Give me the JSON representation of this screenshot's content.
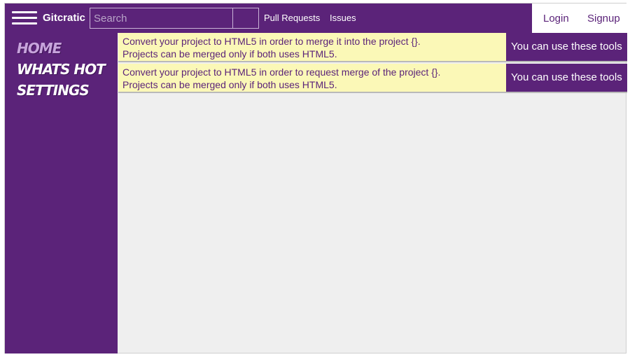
{
  "header": {
    "brand": "Gitcratic",
    "search": {
      "placeholder": "Search",
      "value": ""
    },
    "links": [
      "Pull Requests",
      "Issues"
    ],
    "auth": {
      "login": "Login",
      "signup": "Signup"
    }
  },
  "sidebar": {
    "items": [
      {
        "label": "Home",
        "active": true
      },
      {
        "label": "Whats Hot",
        "active": false
      },
      {
        "label": "Settings",
        "active": false
      }
    ]
  },
  "notices": [
    {
      "line1": "Convert your project to HTML5 in order to merge it into the project {}.",
      "line2": "Projects can be merged only if both uses HTML5.",
      "tools": "You can use these tools"
    },
    {
      "line1": "Convert your project to HTML5 in order to request merge of the project {}.",
      "line2": "Projects can be merged only if both uses HTML5.",
      "tools": "You can use these tools"
    }
  ],
  "icons": {
    "menu": "hamburger-menu-icon"
  },
  "colors": {
    "brand_purple": "#5b2379",
    "notice_yellow": "#fbf8b7",
    "active_sidebar": "#c7a4dc",
    "content_bg": "#efefef"
  }
}
